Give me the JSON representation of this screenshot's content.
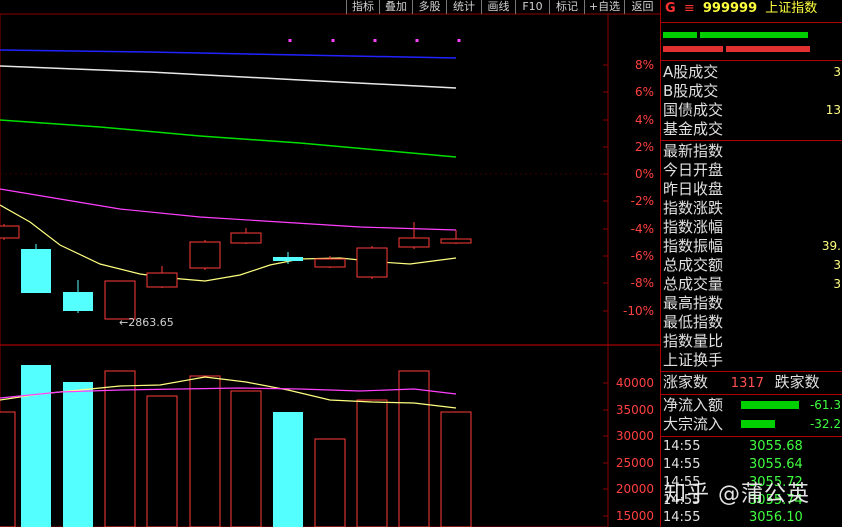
{
  "toolbar": {
    "items": [
      "指标",
      "叠加",
      "多股",
      "统计",
      "画线",
      "F10",
      "标记",
      "+自选",
      "返回"
    ]
  },
  "chart": {
    "price_axis": [
      "8%",
      "6%",
      "4%",
      "2%",
      "0%",
      "-2%",
      "-4%",
      "-6%",
      "-8%",
      "-10%"
    ],
    "volume_axis": [
      "40000",
      "35000",
      "30000",
      "25000",
      "20000",
      "15000"
    ],
    "low_annotation": "←2863.65",
    "colors": {
      "up": "#ff3c3c",
      "down": "#54ffff",
      "ma_white": "#e8e8e8",
      "ma_yellow": "#ffff80",
      "ma_magenta": "#ff40ff",
      "ma_green": "#00e000",
      "ma_blue": "#2222ff",
      "grid": "#8b0000"
    }
  },
  "panel": {
    "header": {
      "prefix": "G",
      "menu_icon": "menu-icon",
      "code": "999999",
      "name": "上证指数"
    },
    "turnover": [
      {
        "label": "A股成交",
        "value": "3"
      },
      {
        "label": "B股成交",
        "value": ""
      },
      {
        "label": "国债成交",
        "value": "13"
      },
      {
        "label": "基金成交",
        "value": ""
      }
    ],
    "stats": [
      {
        "label": "最新指数",
        "value": ""
      },
      {
        "label": "今日开盘",
        "value": ""
      },
      {
        "label": "昨日收盘",
        "value": ""
      },
      {
        "label": "指数涨跌",
        "value": ""
      },
      {
        "label": "指数涨幅",
        "value": ""
      },
      {
        "label": "指数振幅",
        "value": "39."
      },
      {
        "label": "总成交额",
        "value": "3"
      },
      {
        "label": "总成交量",
        "value": "3"
      },
      {
        "label": "最高指数",
        "value": ""
      },
      {
        "label": "最低指数",
        "value": ""
      },
      {
        "label": "指数量比",
        "value": ""
      },
      {
        "label": "上证换手",
        "value": ""
      }
    ],
    "breadth": {
      "up_label": "涨家数",
      "up_count": "1317",
      "down_label": "跌家数"
    },
    "flows": [
      {
        "label": "净流入额",
        "value": "-61.3"
      },
      {
        "label": "大宗流入",
        "value": "-32.2"
      }
    ],
    "ticks": [
      {
        "time": "14:55",
        "price": "3055.68"
      },
      {
        "time": "14:55",
        "price": "3055.64"
      },
      {
        "time": "14:55",
        "price": "3055.72"
      },
      {
        "time": "14:55",
        "price": "3055.74"
      },
      {
        "time": "14:55",
        "price": "3056.10"
      }
    ]
  },
  "watermark": "知乎 @蒲公英"
}
